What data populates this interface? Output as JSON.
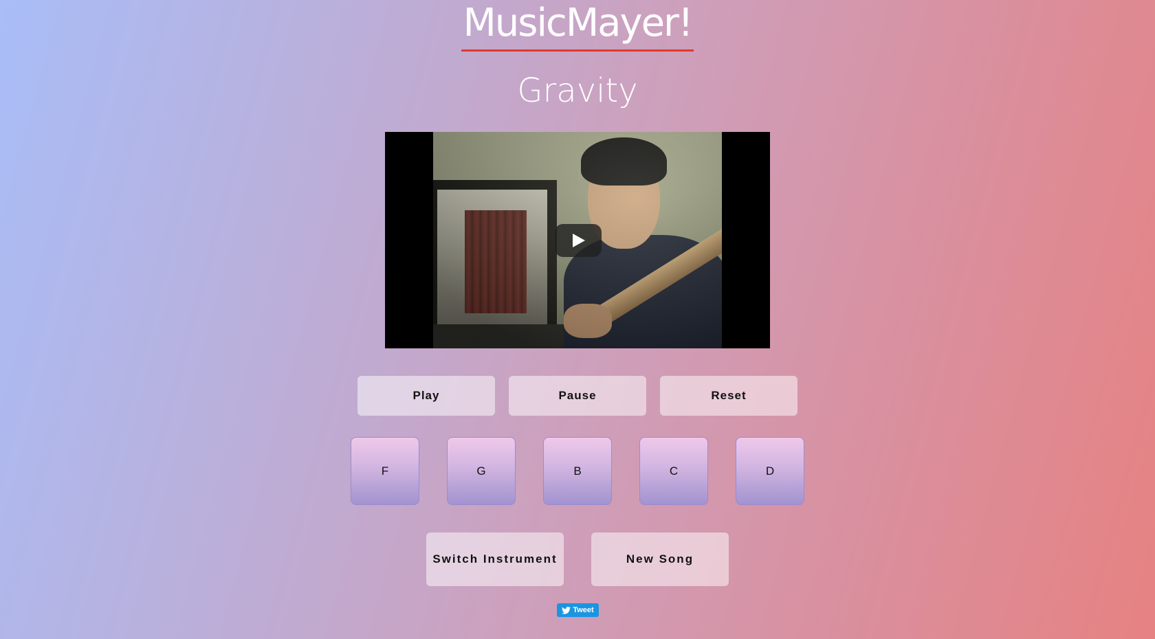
{
  "header": {
    "site_title": "MusicMayer!",
    "song_title": "Gravity"
  },
  "video": {
    "play_icon": "play-icon"
  },
  "controls": {
    "play_label": "Play",
    "pause_label": "Pause",
    "reset_label": "Reset"
  },
  "notes": [
    "F",
    "G",
    "B",
    "C",
    "D"
  ],
  "actions": {
    "switch_instrument_label": "Switch Instrument",
    "new_song_label": "New Song"
  },
  "social": {
    "tweet_label": "Tweet",
    "tweet_icon": "twitter-bird-icon"
  },
  "colors": {
    "title_underline": "#e0392e",
    "tweet_button": "#1b95e0"
  }
}
